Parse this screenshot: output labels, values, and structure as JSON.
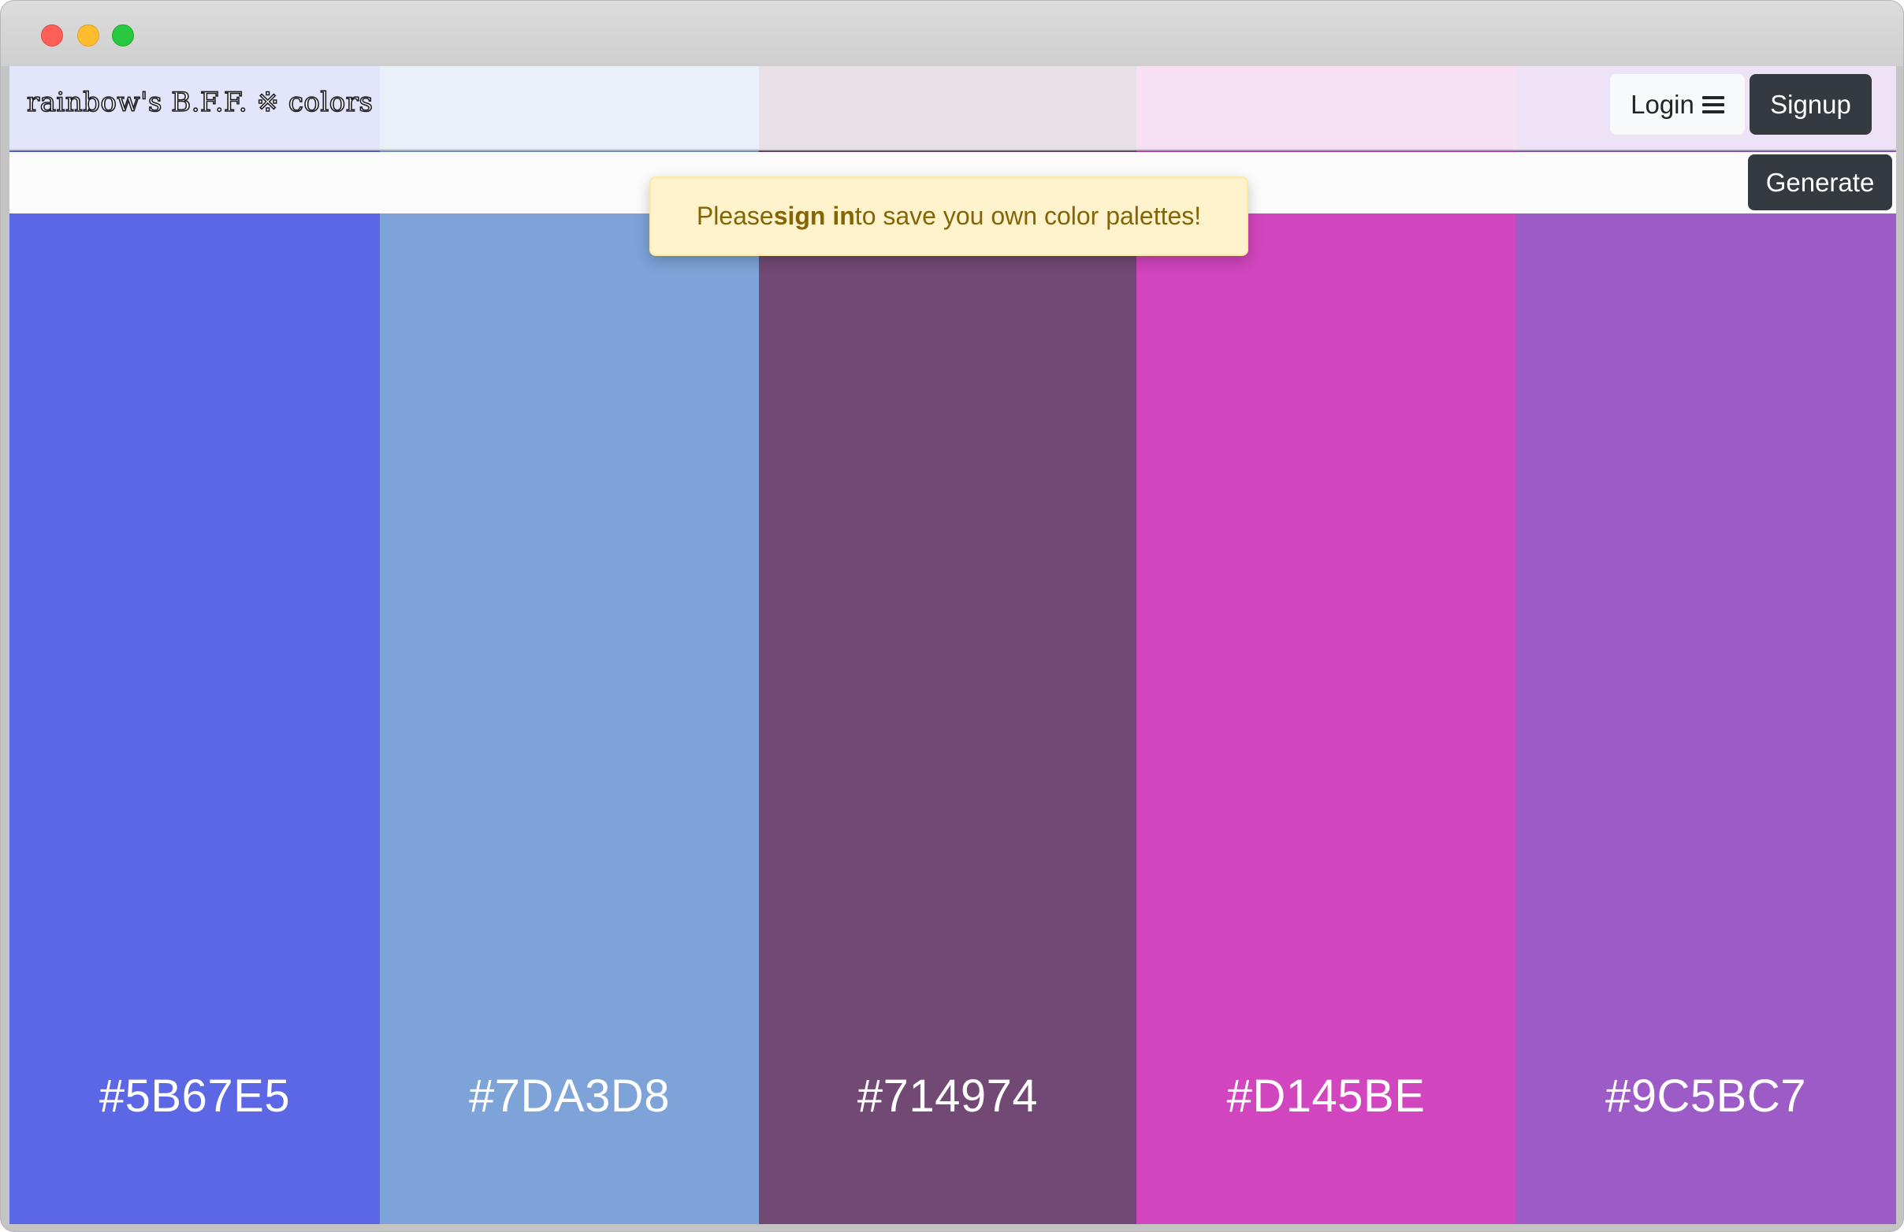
{
  "window": {
    "controls": [
      "close",
      "minimize",
      "zoom"
    ]
  },
  "navbar": {
    "brand": "rainbow's B.F.F. ※ colors",
    "login_label": "Login",
    "login_icon": "hamburger-menu-icon",
    "signup_label": "Signup"
  },
  "toolbar": {
    "generate_label": "Generate"
  },
  "alert": {
    "prefix": "Please ",
    "link": "sign in",
    "suffix": " to save you own color palettes!"
  },
  "palette": {
    "colors": [
      {
        "hex": "#5B67E5",
        "display": "#5B67E5"
      },
      {
        "hex": "#7DA3D8",
        "display": "#7DA3D8"
      },
      {
        "hex": "#714974",
        "display": "#714974"
      },
      {
        "hex": "#D145BE",
        "display": "#D145BE"
      },
      {
        "hex": "#9C5BC7",
        "display": "#9C5BC7"
      }
    ]
  },
  "theme": {
    "dark_button": "#343a40",
    "light_button": "#f8f9fa",
    "alert_bg": "#fff3cd",
    "alert_text": "#856404"
  }
}
